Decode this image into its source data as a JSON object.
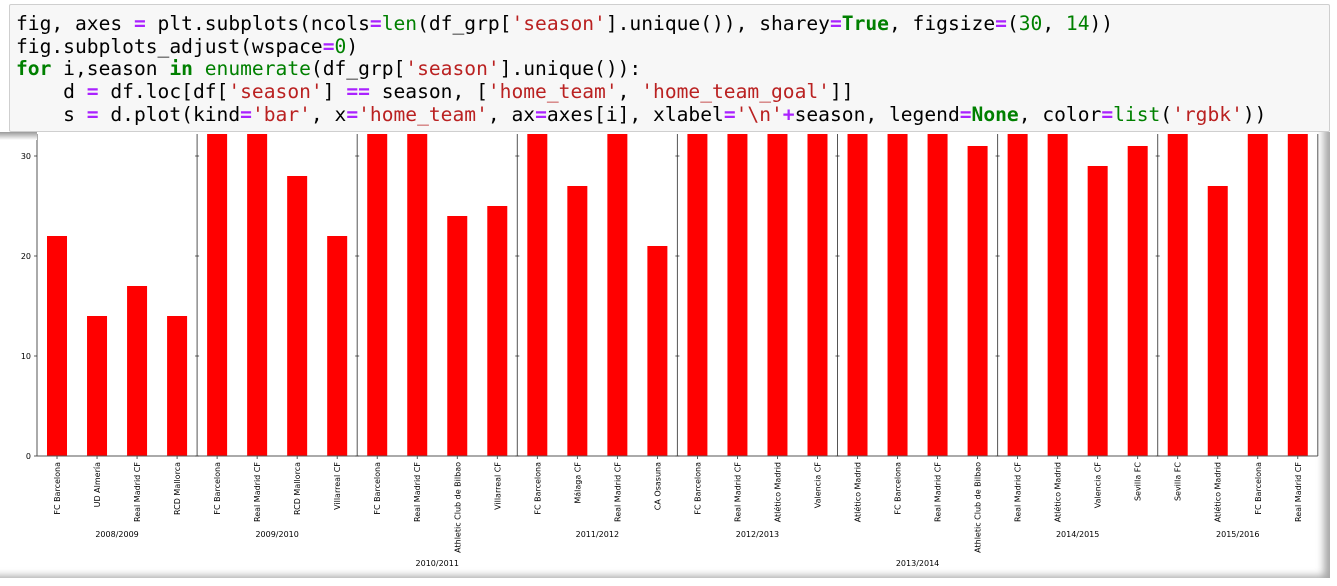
{
  "code_cell": {
    "lines": [
      [
        [
          "p",
          "fig, axes "
        ],
        [
          "o",
          "="
        ],
        [
          "p",
          " plt.subplots(ncols"
        ],
        [
          "o",
          "="
        ],
        [
          "b",
          "len"
        ],
        [
          "p",
          "(df_grp["
        ],
        [
          "s",
          "'season'"
        ],
        [
          "p",
          "].unique()), sharey"
        ],
        [
          "o",
          "="
        ],
        [
          "k",
          "True"
        ],
        [
          "p",
          ", figsize"
        ],
        [
          "o",
          "="
        ],
        [
          "p",
          "("
        ],
        [
          "n",
          "30"
        ],
        [
          "p",
          ", "
        ],
        [
          "n",
          "14"
        ],
        [
          "p",
          "))"
        ]
      ],
      [
        [
          "p",
          "fig.subplots_adjust(wspace"
        ],
        [
          "o",
          "="
        ],
        [
          "n",
          "0"
        ],
        [
          "p",
          ")"
        ]
      ],
      [
        [
          "k",
          "for"
        ],
        [
          "p",
          " i,season "
        ],
        [
          "k",
          "in"
        ],
        [
          "p",
          " "
        ],
        [
          "b",
          "enumerate"
        ],
        [
          "p",
          "(df_grp["
        ],
        [
          "s",
          "'season'"
        ],
        [
          "p",
          "].unique()):"
        ]
      ],
      [
        [
          "p",
          "    d "
        ],
        [
          "o",
          "="
        ],
        [
          "p",
          " df.loc[df["
        ],
        [
          "s",
          "'season'"
        ],
        [
          "p",
          "] "
        ],
        [
          "o",
          "=="
        ],
        [
          "p",
          " season, ["
        ],
        [
          "s",
          "'home_team'"
        ],
        [
          "p",
          ", "
        ],
        [
          "s",
          "'home_team_goal'"
        ],
        [
          "p",
          "]]"
        ]
      ],
      [
        [
          "p",
          "    s "
        ],
        [
          "o",
          "="
        ],
        [
          "p",
          " d.plot(kind"
        ],
        [
          "o",
          "="
        ],
        [
          "s",
          "'bar'"
        ],
        [
          "p",
          ", x"
        ],
        [
          "o",
          "="
        ],
        [
          "s",
          "'home_team'"
        ],
        [
          "p",
          ", ax"
        ],
        [
          "o",
          "="
        ],
        [
          "p",
          "axes[i], xlabel"
        ],
        [
          "o",
          "="
        ],
        [
          "s",
          "'\\n'"
        ],
        [
          "o",
          "+"
        ],
        [
          "p",
          "season, legend"
        ],
        [
          "o",
          "="
        ],
        [
          "k",
          "None"
        ],
        [
          "p",
          ", color"
        ],
        [
          "o",
          "="
        ],
        [
          "b",
          "list"
        ],
        [
          "p",
          "("
        ],
        [
          "s",
          "'rgbk'"
        ],
        [
          "p",
          "))"
        ]
      ]
    ]
  },
  "chart_data": {
    "type": "bar",
    "sharey": true,
    "ylim": [
      0,
      32.2
    ],
    "yticks": [
      0,
      10,
      20,
      30
    ],
    "bar_color": "#ff0000",
    "grid": false,
    "legend": "none",
    "note_clipped": "bars marked 32.2 extend beyond the visible top of the axis",
    "panels": [
      {
        "xlabel": "2008/2009",
        "categories": [
          "FC Barcelona",
          "UD Almería",
          "Real Madrid CF",
          "RCD Mallorca"
        ],
        "values": [
          22,
          14,
          17,
          14
        ]
      },
      {
        "xlabel": "2009/2010",
        "categories": [
          "FC Barcelona",
          "Real Madrid CF",
          "RCD Mallorca",
          "Villarreal CF"
        ],
        "values": [
          32.2,
          32.2,
          28,
          22
        ]
      },
      {
        "xlabel": "2010/2011",
        "categories": [
          "FC Barcelona",
          "Real Madrid CF",
          "Athletic Club de Bilbao",
          "Villarreal CF"
        ],
        "values": [
          32.2,
          32.2,
          24,
          25
        ]
      },
      {
        "xlabel": "2011/2012",
        "categories": [
          "FC Barcelona",
          "Málaga CF",
          "Real Madrid CF",
          "CA Osasuna"
        ],
        "values": [
          32.2,
          27,
          32.2,
          21
        ]
      },
      {
        "xlabel": "2012/2013",
        "categories": [
          "FC Barcelona",
          "Real Madrid CF",
          "Atlético Madrid",
          "Valencia CF"
        ],
        "values": [
          32.2,
          32.2,
          32.2,
          32.2
        ]
      },
      {
        "xlabel": "2013/2014",
        "categories": [
          "Atlético Madrid",
          "FC Barcelona",
          "Real Madrid CF",
          "Athletic Club de Bilbao"
        ],
        "values": [
          32.2,
          32.2,
          32.2,
          31
        ]
      },
      {
        "xlabel": "2014/2015",
        "categories": [
          "Real Madrid CF",
          "Atlético Madrid",
          "Valencia CF",
          "Sevilla FC"
        ],
        "values": [
          32.2,
          32.2,
          29,
          31
        ]
      },
      {
        "xlabel": "2015/2016",
        "categories": [
          "Sevilla FC",
          "Atlético Madrid",
          "FC Barcelona",
          "Real Madrid CF"
        ],
        "values": [
          32.2,
          27,
          32.2,
          32.2
        ]
      }
    ]
  }
}
